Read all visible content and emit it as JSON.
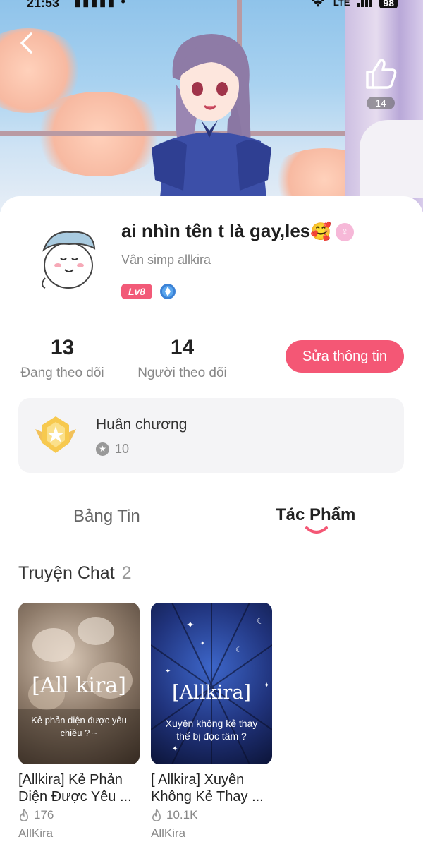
{
  "status_bar": {
    "time": "21:53",
    "network": "LTE",
    "battery": "98"
  },
  "banner": {
    "like_count": "14"
  },
  "profile": {
    "name": "ai nhìn tên t là gay,les",
    "name_emoji": "🥰",
    "subname": "Vân simp allkira",
    "level": "Lv8"
  },
  "stats": {
    "following_count": "13",
    "following_label": "Đang theo dõi",
    "followers_count": "14",
    "followers_label": "Người theo dõi",
    "edit_button": "Sửa thông tin"
  },
  "medal": {
    "title": "Huân chương",
    "count": "10"
  },
  "tabs": [
    {
      "label": "Bảng Tin",
      "active": false
    },
    {
      "label": "Tác Phẩm",
      "active": true
    }
  ],
  "section": {
    "title": "Truyện Chat",
    "count": "2"
  },
  "stories": [
    {
      "cover_title": "[All kira]",
      "cover_subtitle": "Kẻ phản diện được yêu chiều ? ~",
      "title": "[Allkira] Kẻ Phản Diện Được Yêu ...",
      "reads": "176",
      "author": "AllKira"
    },
    {
      "cover_title": "[Allkira]",
      "cover_subtitle": "Xuyên không kẻ thay thế bị đọc tâm ?",
      "title": "[ Allkira] Xuyên Không Kẻ Thay ...",
      "reads": "10.1K",
      "author": "AllKira"
    }
  ],
  "colors": {
    "accent": "#f45775",
    "level_badge": "#f25a78",
    "muted_text": "#888888",
    "card_bg": "#f4f4f6"
  }
}
